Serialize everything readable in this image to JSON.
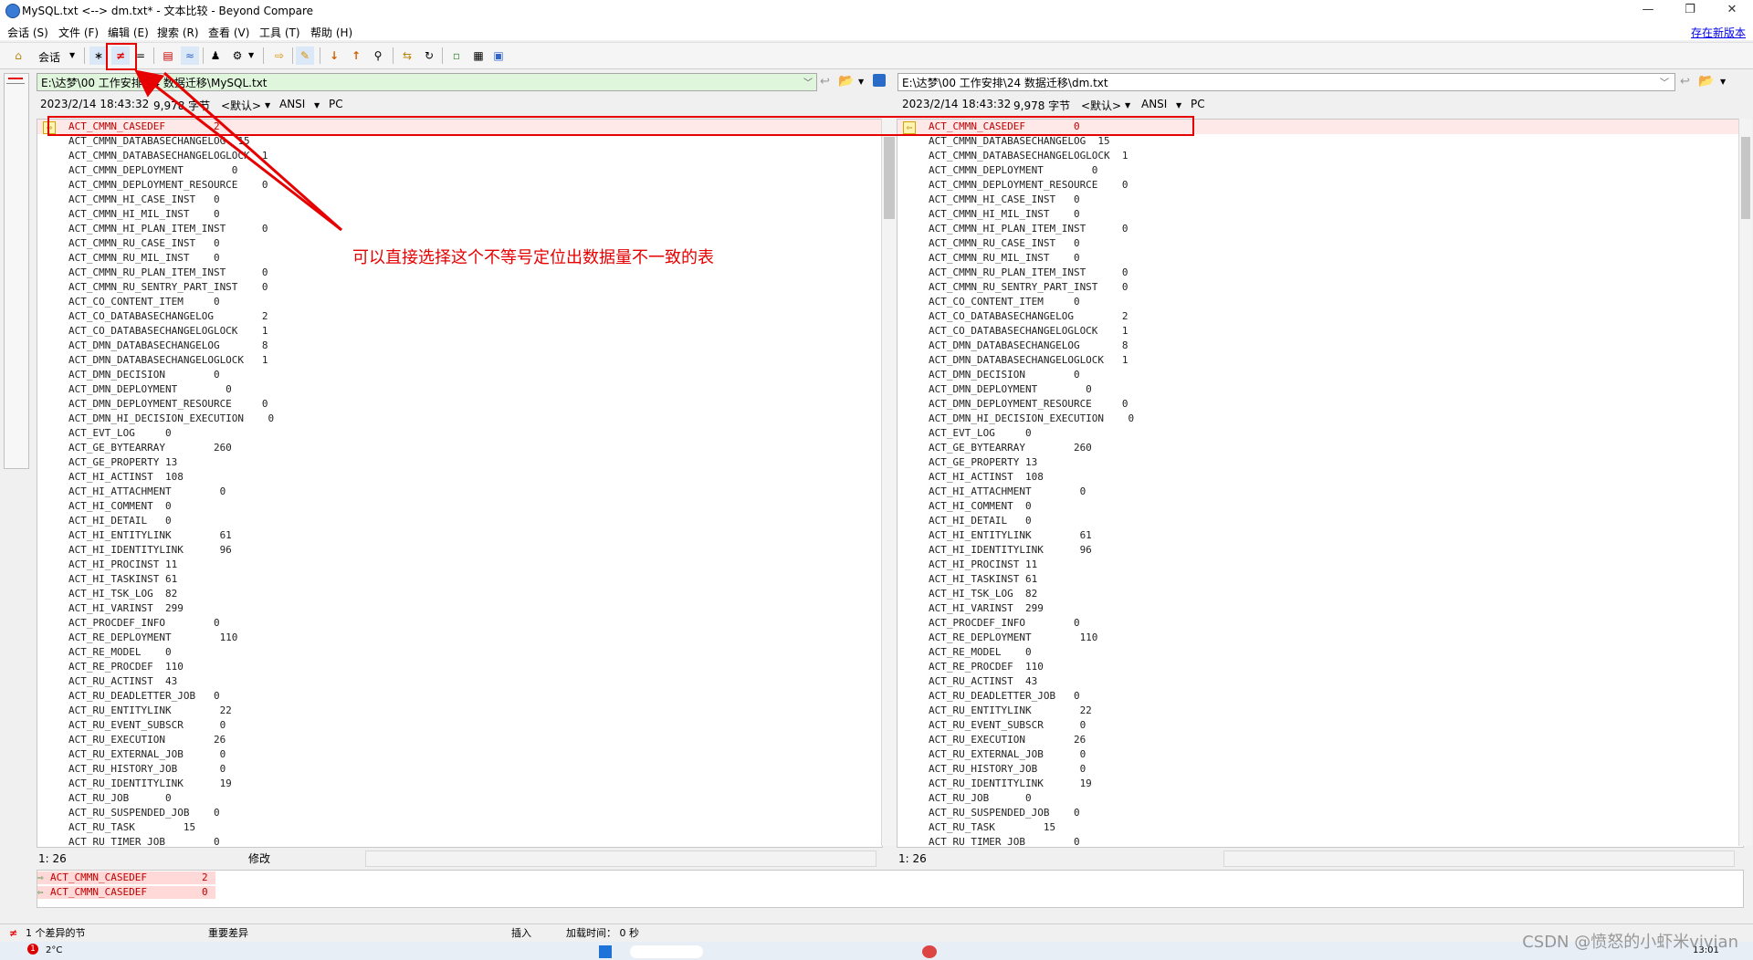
{
  "window": {
    "title": "MySQL.txt <--> dm.txt* - 文本比较 - Beyond Compare",
    "controls": [
      "—",
      "❐",
      "✕"
    ]
  },
  "menu": {
    "items": [
      "会话 (S)",
      "文件 (F)",
      "编辑 (E)",
      "搜索 (R)",
      "查看 (V)",
      "工具 (T)",
      "帮助 (H)"
    ],
    "new_version": "存在新版本"
  },
  "toolbar": {
    "session_label": "会话",
    "buttons": [
      {
        "name": "home-icon",
        "glyph": "⌂"
      },
      {
        "name": "all-icon",
        "glyph": "∗"
      },
      {
        "name": "diffs-icon",
        "glyph": "≠"
      },
      {
        "name": "same-icon",
        "glyph": "="
      },
      {
        "name": "rules-icon",
        "glyph": "▤"
      },
      {
        "name": "ignore-icon",
        "glyph": "≈"
      },
      {
        "name": "person-icon",
        "glyph": "♟"
      },
      {
        "name": "format-icon",
        "glyph": "⚙"
      },
      {
        "name": "swap-icon",
        "glyph": "⇨"
      },
      {
        "name": "edit-icon",
        "glyph": "✎"
      },
      {
        "name": "next-diff-icon",
        "glyph": "↓"
      },
      {
        "name": "prev-diff-icon",
        "glyph": "↑"
      },
      {
        "name": "find-icon",
        "glyph": "⚲"
      },
      {
        "name": "merge-icon",
        "glyph": "⇆"
      },
      {
        "name": "reload-icon",
        "glyph": "↻"
      },
      {
        "name": "page-icon",
        "glyph": "▫"
      },
      {
        "name": "view-icon",
        "glyph": "▦"
      },
      {
        "name": "report-icon",
        "glyph": "▣"
      }
    ]
  },
  "left": {
    "path": "E:\\达梦\\00 工作安排\\24 数据迁移\\MySQL.txt",
    "date": "2023/2/14 18:43:32",
    "size": "9,978 字节",
    "format": "<默认>",
    "encoding": "ANSI",
    "lineend": "PC",
    "position": "1: 26",
    "mode": "修改"
  },
  "right": {
    "path": "E:\\达梦\\00 工作安排\\24 数据迁移\\dm.txt",
    "date": "2023/2/14 18:43:32",
    "size": "9,978 字节",
    "format": "<默认>",
    "encoding": "ANSI",
    "lineend": "PC",
    "position": "1: 26"
  },
  "rows": [
    {
      "name": "ACT_CMMN_CASEDEF",
      "left": "2",
      "right": "0",
      "diff": true,
      "pad": 8
    },
    {
      "name": "ACT_CMMN_DATABASECHANGELOG",
      "left": "15",
      "right": "15",
      "diff": false,
      "pad": 2
    },
    {
      "name": "ACT_CMMN_DATABASECHANGELOGLOCK",
      "left": "1",
      "right": "1",
      "diff": false,
      "pad": 2
    },
    {
      "name": "ACT_CMMN_DEPLOYMENT",
      "left": "0",
      "right": "0",
      "diff": false,
      "pad": 8
    },
    {
      "name": "ACT_CMMN_DEPLOYMENT_RESOURCE",
      "left": "0",
      "right": "0",
      "diff": false,
      "pad": 4
    },
    {
      "name": "ACT_CMMN_HI_CASE_INST",
      "left": "0",
      "right": "0",
      "diff": false,
      "pad": 3
    },
    {
      "name": "ACT_CMMN_HI_MIL_INST",
      "left": "0",
      "right": "0",
      "diff": false,
      "pad": 4
    },
    {
      "name": "ACT_CMMN_HI_PLAN_ITEM_INST",
      "left": "0",
      "right": "0",
      "diff": false,
      "pad": 6
    },
    {
      "name": "ACT_CMMN_RU_CASE_INST",
      "left": "0",
      "right": "0",
      "diff": false,
      "pad": 3
    },
    {
      "name": "ACT_CMMN_RU_MIL_INST",
      "left": "0",
      "right": "0",
      "diff": false,
      "pad": 4
    },
    {
      "name": "ACT_CMMN_RU_PLAN_ITEM_INST",
      "left": "0",
      "right": "0",
      "diff": false,
      "pad": 6
    },
    {
      "name": "ACT_CMMN_RU_SENTRY_PART_INST",
      "left": "0",
      "right": "0",
      "diff": false,
      "pad": 4
    },
    {
      "name": "ACT_CO_CONTENT_ITEM",
      "left": "0",
      "right": "0",
      "diff": false,
      "pad": 5
    },
    {
      "name": "ACT_CO_DATABASECHANGELOG",
      "left": "2",
      "right": "2",
      "diff": false,
      "pad": 8
    },
    {
      "name": "ACT_CO_DATABASECHANGELOGLOCK",
      "left": "1",
      "right": "1",
      "diff": false,
      "pad": 4
    },
    {
      "name": "ACT_DMN_DATABASECHANGELOG",
      "left": "8",
      "right": "8",
      "diff": false,
      "pad": 7
    },
    {
      "name": "ACT_DMN_DATABASECHANGELOGLOCK",
      "left": "1",
      "right": "1",
      "diff": false,
      "pad": 3
    },
    {
      "name": "ACT_DMN_DECISION",
      "left": "0",
      "right": "0",
      "diff": false,
      "pad": 8
    },
    {
      "name": "ACT_DMN_DEPLOYMENT",
      "left": "0",
      "right": "0",
      "diff": false,
      "pad": 8
    },
    {
      "name": "ACT_DMN_DEPLOYMENT_RESOURCE",
      "left": "0",
      "right": "0",
      "diff": false,
      "pad": 5
    },
    {
      "name": "ACT_DMN_HI_DECISION_EXECUTION",
      "left": "0",
      "right": "0",
      "diff": false,
      "pad": 4
    },
    {
      "name": "ACT_EVT_LOG",
      "left": "0",
      "right": "0",
      "diff": false,
      "pad": 5
    },
    {
      "name": "ACT_GE_BYTEARRAY",
      "left": "260",
      "right": "260",
      "diff": false,
      "pad": 8
    },
    {
      "name": "ACT_GE_PROPERTY",
      "left": "13",
      "right": "13",
      "diff": false,
      "pad": 1
    },
    {
      "name": "ACT_HI_ACTINST",
      "left": "108",
      "right": "108",
      "diff": false,
      "pad": 2
    },
    {
      "name": "ACT_HI_ATTACHMENT",
      "left": "0",
      "right": "0",
      "diff": false,
      "pad": 8
    },
    {
      "name": "ACT_HI_COMMENT",
      "left": "0",
      "right": "0",
      "diff": false,
      "pad": 2
    },
    {
      "name": "ACT_HI_DETAIL",
      "left": "0",
      "right": "0",
      "diff": false,
      "pad": 3
    },
    {
      "name": "ACT_HI_ENTITYLINK",
      "left": "61",
      "right": "61",
      "diff": false,
      "pad": 8
    },
    {
      "name": "ACT_HI_IDENTITYLINK",
      "left": "96",
      "right": "96",
      "diff": false,
      "pad": 6
    },
    {
      "name": "ACT_HI_PROCINST",
      "left": "11",
      "right": "11",
      "diff": false,
      "pad": 1
    },
    {
      "name": "ACT_HI_TASKINST",
      "left": "61",
      "right": "61",
      "diff": false,
      "pad": 1
    },
    {
      "name": "ACT_HI_TSK_LOG",
      "left": "82",
      "right": "82",
      "diff": false,
      "pad": 2
    },
    {
      "name": "ACT_HI_VARINST",
      "left": "299",
      "right": "299",
      "diff": false,
      "pad": 2
    },
    {
      "name": "ACT_PROCDEF_INFO",
      "left": "0",
      "right": "0",
      "diff": false,
      "pad": 8
    },
    {
      "name": "ACT_RE_DEPLOYMENT",
      "left": "110",
      "right": "110",
      "diff": false,
      "pad": 8
    },
    {
      "name": "ACT_RE_MODEL",
      "left": "0",
      "right": "0",
      "diff": false,
      "pad": 4
    },
    {
      "name": "ACT_RE_PROCDEF",
      "left": "110",
      "right": "110",
      "diff": false,
      "pad": 2
    },
    {
      "name": "ACT_RU_ACTINST",
      "left": "43",
      "right": "43",
      "diff": false,
      "pad": 2
    },
    {
      "name": "ACT_RU_DEADLETTER_JOB",
      "left": "0",
      "right": "0",
      "diff": false,
      "pad": 3
    },
    {
      "name": "ACT_RU_ENTITYLINK",
      "left": "22",
      "right": "22",
      "diff": false,
      "pad": 8
    },
    {
      "name": "ACT_RU_EVENT_SUBSCR",
      "left": "0",
      "right": "0",
      "diff": false,
      "pad": 6
    },
    {
      "name": "ACT_RU_EXECUTION",
      "left": "26",
      "right": "26",
      "diff": false,
      "pad": 8
    },
    {
      "name": "ACT_RU_EXTERNAL_JOB",
      "left": "0",
      "right": "0",
      "diff": false,
      "pad": 6
    },
    {
      "name": "ACT_RU_HISTORY_JOB",
      "left": "0",
      "right": "0",
      "diff": false,
      "pad": 7
    },
    {
      "name": "ACT_RU_IDENTITYLINK",
      "left": "19",
      "right": "19",
      "diff": false,
      "pad": 6
    },
    {
      "name": "ACT_RU_JOB",
      "left": "0",
      "right": "0",
      "diff": false,
      "pad": 6
    },
    {
      "name": "ACT_RU_SUSPENDED_JOB",
      "left": "0",
      "right": "0",
      "diff": false,
      "pad": 4
    },
    {
      "name": "ACT_RU_TASK",
      "left": "15",
      "right": "15",
      "diff": false,
      "pad": 8
    },
    {
      "name": "ACT_RU_TIMER_JOB",
      "left": "0",
      "right": "0",
      "diff": false,
      "pad": 8
    }
  ],
  "detail": {
    "left_line": "ACT_CMMN_CASEDEF",
    "left_value": "2",
    "right_line": "ACT_CMMN_CASEDEF",
    "right_value": "0"
  },
  "status": {
    "diff_count": "1 个差异的节",
    "importance": "重要差异",
    "insert_mode": "插入",
    "load_time": "加载时间： 0 秒"
  },
  "annotation": {
    "text": "可以直接选择这个不等号定位出数据量不一致的表"
  },
  "taskbar": {
    "temperature": "2°C",
    "clock": "13:01",
    "watermark": "CSDN @愤怒的小虾米vivian"
  },
  "colors": {
    "annotation": "#e60000",
    "diff_text": "#c00000",
    "diff_bg": "#ffe8e8",
    "left_path_bg": "#dff5dc"
  }
}
